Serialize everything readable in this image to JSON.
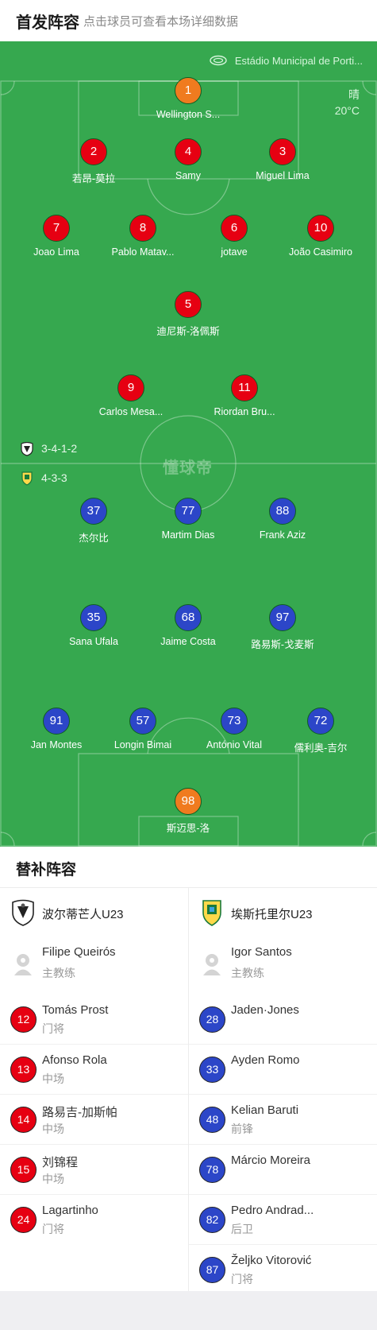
{
  "header": {
    "title": "首发阵容",
    "subtitle": "点击球员可查看本场详细数据"
  },
  "pitch": {
    "stadium": "Estádio Municipal de Porti...",
    "stadium_icon": "stadium-icon",
    "weather": "晴",
    "temperature": "20°C",
    "watermark": "懂球帝",
    "colors": {
      "grass": "#36a84f",
      "home": "#e60012",
      "away": "#2c46c8",
      "keeper": "#f07b1f"
    }
  },
  "home": {
    "team": "波尔蒂芒人U23",
    "formation": "3-4-1-2",
    "players": [
      {
        "number": "1",
        "name": "Wellington S...",
        "kit": "orange"
      },
      {
        "number": "2",
        "name": "若昂-莫拉",
        "kit": "red"
      },
      {
        "number": "4",
        "name": "Samy",
        "kit": "red"
      },
      {
        "number": "3",
        "name": "Miguel Lima",
        "kit": "red"
      },
      {
        "number": "7",
        "name": "Joao Lima",
        "kit": "red"
      },
      {
        "number": "8",
        "name": "Pablo Matav...",
        "kit": "red"
      },
      {
        "number": "6",
        "name": "jotave",
        "kit": "red"
      },
      {
        "number": "10",
        "name": "João Casimiro",
        "kit": "red"
      },
      {
        "number": "5",
        "name": "迪尼斯-洛佩斯",
        "kit": "red"
      },
      {
        "number": "9",
        "name": "Carlos Mesa...",
        "kit": "red"
      },
      {
        "number": "11",
        "name": "Riordan Bru...",
        "kit": "red"
      }
    ]
  },
  "away": {
    "team": "埃斯托里尔U23",
    "formation": "4-3-3",
    "players": [
      {
        "number": "37",
        "name": "杰尔比",
        "kit": "blue"
      },
      {
        "number": "77",
        "name": "Martim Dias",
        "kit": "blue"
      },
      {
        "number": "88",
        "name": "Frank Aziz",
        "kit": "blue"
      },
      {
        "number": "35",
        "name": "Sana Ufala",
        "kit": "blue"
      },
      {
        "number": "68",
        "name": "Jaime Costa",
        "kit": "blue"
      },
      {
        "number": "97",
        "name": "路易斯-戈麦斯",
        "kit": "blue"
      },
      {
        "number": "91",
        "name": "Jan Montes",
        "kit": "blue"
      },
      {
        "number": "57",
        "name": "Longin Bimai",
        "kit": "blue"
      },
      {
        "number": "73",
        "name": "António Vital",
        "kit": "blue"
      },
      {
        "number": "72",
        "name": "儒利奥-吉尔",
        "kit": "blue"
      },
      {
        "number": "98",
        "name": "斯迈思-洛",
        "kit": "orange"
      }
    ]
  },
  "subs": {
    "title": "替补阵容",
    "home": {
      "team": "波尔蒂芒人U23",
      "coach": {
        "name": "Filipe Queirós",
        "role": "主教练"
      },
      "players": [
        {
          "number": "12",
          "name": "Tomás Prost",
          "position": "门将"
        },
        {
          "number": "13",
          "name": "Afonso Rola",
          "position": "中场"
        },
        {
          "number": "14",
          "name": "路易吉-加斯帕",
          "position": "中场"
        },
        {
          "number": "15",
          "name": "刘锦程",
          "position": "中场"
        },
        {
          "number": "24",
          "name": "Lagartinho",
          "position": "门将"
        }
      ]
    },
    "away": {
      "team": "埃斯托里尔U23",
      "coach": {
        "name": "Igor Santos",
        "role": "主教练"
      },
      "players": [
        {
          "number": "28",
          "name": "Jaden·Jones",
          "position": ""
        },
        {
          "number": "33",
          "name": "Ayden Romo",
          "position": ""
        },
        {
          "number": "48",
          "name": "Kelian Baruti",
          "position": "前锋"
        },
        {
          "number": "78",
          "name": "Márcio Moreira",
          "position": ""
        },
        {
          "number": "82",
          "name": "Pedro Andrad...",
          "position": "后卫"
        },
        {
          "number": "87",
          "name": "Željko Vitorović",
          "position": "门将"
        }
      ]
    }
  }
}
